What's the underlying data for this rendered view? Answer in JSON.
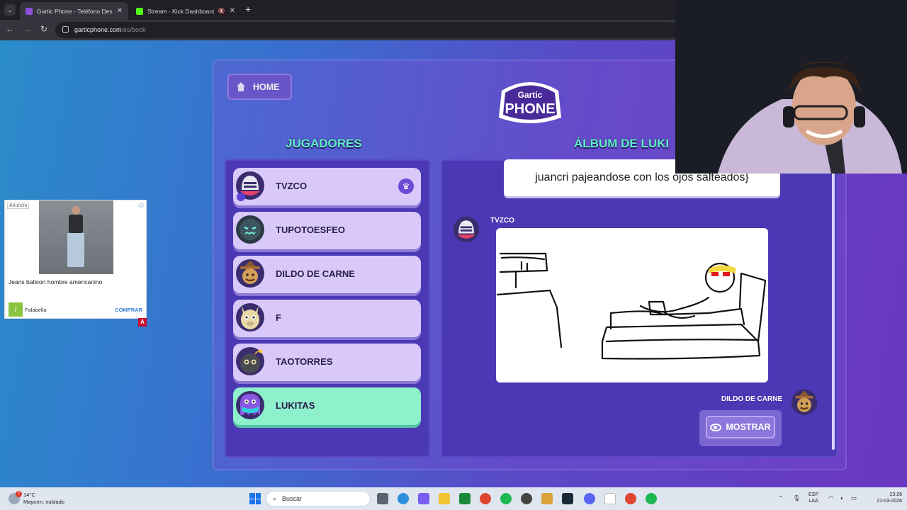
{
  "browser": {
    "tabs": [
      {
        "title": "Gartic Phone - Teléfono Descon",
        "active": true
      },
      {
        "title": "Stream - Kick Dashboard",
        "active": false
      }
    ],
    "url_host": "garticphone.com",
    "url_path": "/es/book"
  },
  "ad": {
    "tag": "Anuncio",
    "text": "Jeans balloon hombre americanino",
    "brand": "Falabella",
    "cta": "COMPRAR",
    "badge": "A"
  },
  "game": {
    "home_label": "HOME",
    "logo_top": "Gartic",
    "logo_bottom": "PHONE",
    "players_title": "JUGADORES",
    "album_title": "ÁLBUM DE LUKI",
    "players": [
      {
        "name": "TVZCO",
        "host": true,
        "current": false,
        "avatar": "knight-helmet-icon",
        "avatar_color": "#e9e9f2"
      },
      {
        "name": "TUPOTOESFEO",
        "host": false,
        "current": false,
        "avatar": "monster-icon",
        "avatar_color": "#2c3a44"
      },
      {
        "name": "DILDO DE CARNE",
        "host": false,
        "current": false,
        "avatar": "cowboy-icon",
        "avatar_color": "#c9964a"
      },
      {
        "name": "F",
        "host": false,
        "current": false,
        "avatar": "llama-icon",
        "avatar_color": "#e8d9a6"
      },
      {
        "name": "TAOTORRES",
        "host": false,
        "current": false,
        "avatar": "bomb-icon",
        "avatar_color": "#4a4a52"
      },
      {
        "name": "LUKITAS",
        "host": false,
        "current": true,
        "avatar": "ghost-icon",
        "avatar_color": "#8a58e0"
      }
    ],
    "album": {
      "phrase": "juancri pajeandose con los ojos salteados}",
      "drawing_author": "TVZCO",
      "next_author": "DILDO DE CARNE",
      "show_label": "MOSTRAR"
    }
  },
  "taskbar": {
    "weather_temp": "14°C",
    "weather_desc": "Mayorm. nublado",
    "search_placeholder": "Buscar",
    "lang_1": "ESP",
    "lang_2": "LAA",
    "time": "23:26",
    "date": "21-03-2026"
  },
  "colors": {
    "accent_green": "#5ef0c4",
    "panel": "#4b38b4",
    "player_card": "#d9c9fb",
    "current_player_card": "#8ff0cc"
  }
}
